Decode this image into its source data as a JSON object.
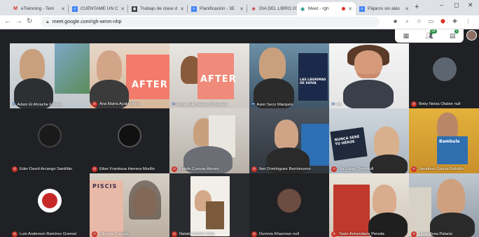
{
  "browser": {
    "tabs": [
      {
        "favicon": "gmail-icon",
        "title": "eTwinning - Tem",
        "active": false
      },
      {
        "favicon": "docs-icon",
        "title": "CUÉNTAME UN C",
        "active": false
      },
      {
        "favicon": "classroom-icon",
        "title": "Trabajo de clase d",
        "active": false
      },
      {
        "favicon": "docs-icon",
        "title": "Planificación - 3E",
        "active": false
      },
      {
        "favicon": "rose-icon",
        "title": "DÍA DEL LIBRO 20",
        "active": false
      },
      {
        "favicon": "meet-icon",
        "title": "Meet - rgh",
        "active": true
      },
      {
        "favicon": "docs-icon",
        "title": "Pájaros sin alas",
        "active": false
      }
    ],
    "new_tab": "+",
    "url": "meet.google.com/rgh-wmm-nhp",
    "window_controls": {
      "minimize": "–",
      "maximize": "◻",
      "close": "✕"
    }
  },
  "meet": {
    "toolbar": {
      "chat_badge": "1",
      "people_count": "28"
    },
    "participants": [
      {
        "name": "Adam El Ahrache Emran",
        "muted": false
      },
      {
        "name": "Ana María Ayala Mora",
        "muted": true
      },
      {
        "name": "Anna Julia Neres De Morais",
        "muted": false
      },
      {
        "name": "Asier Seco Marqués",
        "muted": false
      },
      {
        "name": "Tú",
        "muted": false
      },
      {
        "name": "Beby Noisa Otabor null",
        "muted": true
      },
      {
        "name": "Eder David Arcango Santillán",
        "muted": true
      },
      {
        "name": "Eiker Franksua Herrera Murillo",
        "muted": true
      },
      {
        "name": "Estefe Cuevas Alonso",
        "muted": true
      },
      {
        "name": "Iker Domínguez Barrionuevo",
        "muted": true
      },
      {
        "name": "Jia Liang Chen null",
        "muted": true
      },
      {
        "name": "Jonathan Garcia Rebollo",
        "muted": true
      },
      {
        "name": "Luis Anderson Ramírez Gramal",
        "muted": true
      },
      {
        "name": "Mihaela Bulaiga",
        "muted": true
      },
      {
        "name": "Natalia Muñoz Díaz",
        "muted": true
      },
      {
        "name": "Dumnia Khazroun null",
        "muted": true
      },
      {
        "name": "Tasio Armendariz Pereda",
        "muted": true
      },
      {
        "name": "Unai Mesa Palacio",
        "muted": true
      }
    ],
    "book_texts": {
      "after1": "AFTER",
      "after2": "AFTER",
      "lagrimas": "LAS LÁGRIMAS DE SHIVA",
      "nunca": "NUNCA SERÉ TU HÉROE",
      "bambule": "Bambule",
      "piscis": "PISCIS"
    },
    "colors": {
      "background": "#202124",
      "muted_red": "#d93025",
      "accent_blue": "#8ab4f8"
    }
  }
}
